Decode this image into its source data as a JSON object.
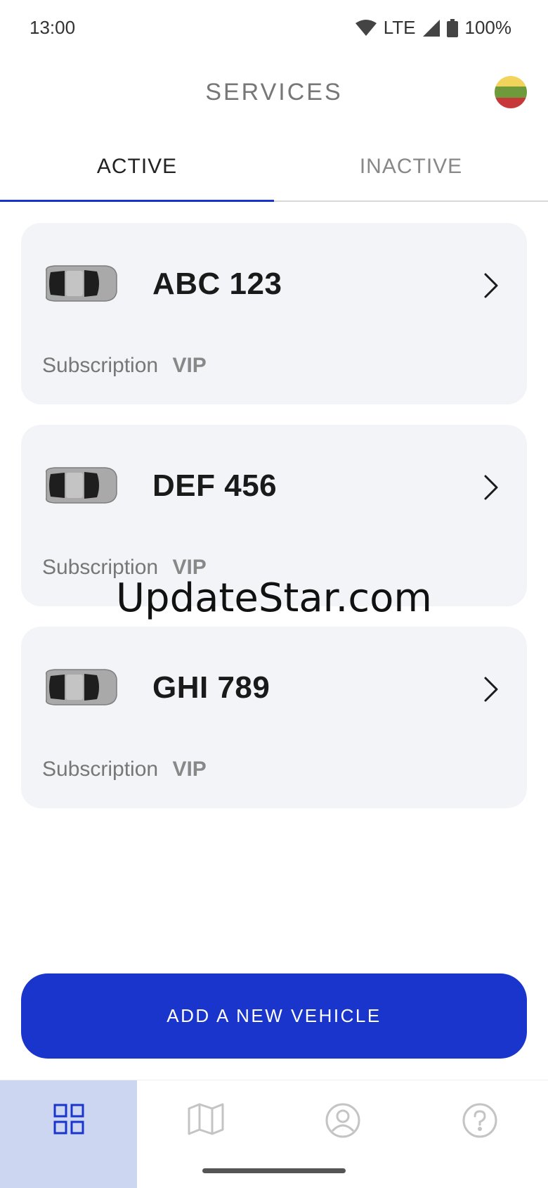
{
  "status_bar": {
    "time": "13:00",
    "network": "LTE",
    "battery": "100%"
  },
  "header": {
    "title": "SERVICES",
    "flag_colors": [
      "#FDB913",
      "#006A44",
      "#C1272D"
    ]
  },
  "tabs": [
    {
      "label": "ACTIVE",
      "active": true
    },
    {
      "label": "INACTIVE",
      "active": false
    }
  ],
  "vehicles": [
    {
      "plate": "ABC 123",
      "subscription_label": "Subscription",
      "subscription_value": "VIP"
    },
    {
      "plate": "DEF 456",
      "subscription_label": "Subscription",
      "subscription_value": "VIP"
    },
    {
      "plate": "GHI 789",
      "subscription_label": "Subscription",
      "subscription_value": "VIP"
    }
  ],
  "watermark": "UpdateStar.com",
  "add_vehicle_label": "ADD A NEW VEHICLE",
  "bottom_nav": [
    {
      "icon": "grid-icon",
      "active": true
    },
    {
      "icon": "map-icon",
      "active": false
    },
    {
      "icon": "profile-icon",
      "active": false
    },
    {
      "icon": "help-icon",
      "active": false
    }
  ],
  "colors": {
    "accent": "#1a35cc",
    "card_bg": "#f3f4f8",
    "nav_active_bg": "#cdd6f1"
  }
}
